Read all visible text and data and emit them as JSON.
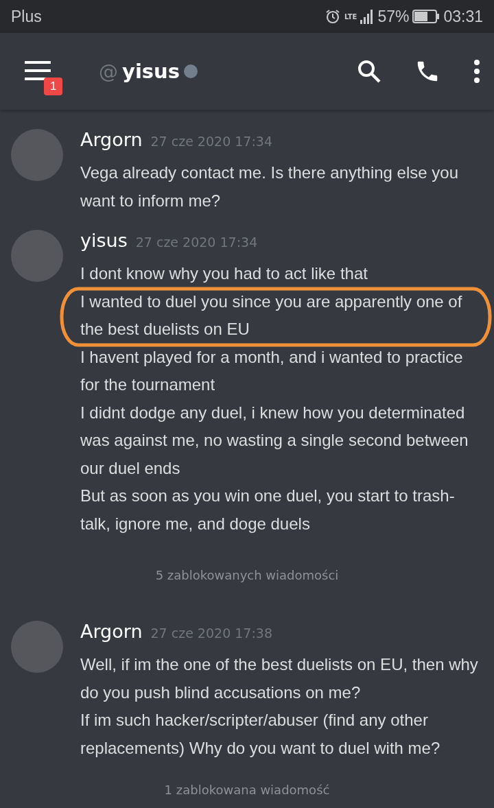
{
  "status_bar": {
    "carrier": "Plus",
    "network": "LTE",
    "battery": "57%",
    "time": "03:31"
  },
  "header": {
    "at": "@",
    "channel": "yisus",
    "notifications": "1"
  },
  "feed": [
    {
      "kind": "message",
      "author": "Argorn",
      "time": "27 cze 2020 17:34",
      "lines": [
        "Vega already contact me. Is there anything else you want to inform me?"
      ]
    },
    {
      "kind": "message",
      "author": "yisus",
      "time": "27 cze 2020 17:34",
      "circled": true,
      "lines": [
        "I dont know why you had to act like that",
        "I wanted to duel you since you are apparently one of the best duelists on EU",
        "I havent played for a month, and i wanted to practice for the tournament",
        "I didnt dodge any duel, i knew how you determinated was against me, no wasting a single second between our duel ends",
        "But as soon as you win one duel, you start to trash-talk, ignore me, and doge duels"
      ]
    },
    {
      "kind": "blocked",
      "text": "5 zablokowanych wiadomości"
    },
    {
      "kind": "message",
      "author": "Argorn",
      "time": "27 cze 2020 17:38",
      "lines": [
        "Well, if im the one of the best duelists on EU, then why do you push blind accusations on me?",
        "If im such hacker/scripter/abuser (find any other replacements) Why do you want to duel with me?"
      ]
    },
    {
      "kind": "blocked",
      "text": "1 zablokowana wiadomość"
    }
  ]
}
